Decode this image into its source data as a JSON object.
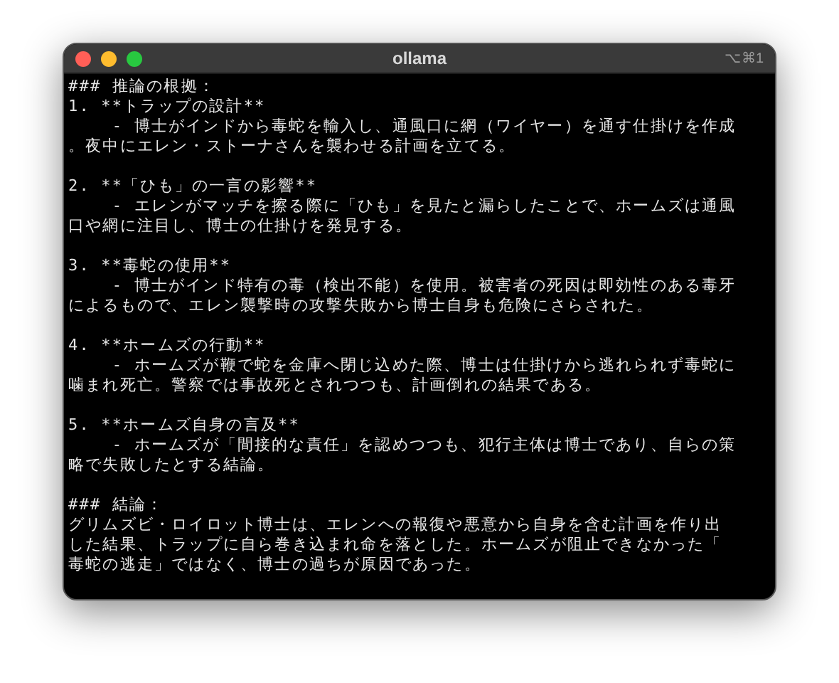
{
  "window": {
    "title": "ollama",
    "shortcut": "⌥⌘1"
  },
  "blocks": [
    {
      "lines": [
        "### 推論の根拠：",
        "1. **トラップの設計**",
        "    - 博士がインドから毒蛇を輸入し、通風口に網（ワイヤー）を通す仕掛けを作成",
        "。夜中にエレン・ストーナさんを襲わせる計画を立てる。"
      ]
    },
    {
      "lines": [
        "2. **「ひも」の一言の影響**",
        "    - エレンがマッチを擦る際に「ひも」を見たと漏らしたことで、ホームズは通風",
        "口や網に注目し、博士の仕掛けを発見する。"
      ]
    },
    {
      "lines": [
        "3. **毒蛇の使用**",
        "    - 博士がインド特有の毒（検出不能）を使用。被害者の死因は即効性のある毒牙",
        "によるもので、エレン襲撃時の攻撃失敗から博士自身も危険にさらされた。"
      ]
    },
    {
      "lines": [
        "4. **ホームズの行動**",
        "    - ホームズが鞭で蛇を金庫へ閉じ込めた際、博士は仕掛けから逃れられず毒蛇に",
        "噛まれ死亡。警察では事故死とされつつも、計画倒れの結果である。"
      ]
    },
    {
      "lines": [
        "5. **ホームズ自身の言及**",
        "    - ホームズが「間接的な責任」を認めつつも、犯行主体は博士であり、自らの策",
        "略で失敗したとする結論。"
      ]
    },
    {
      "lines": [
        "### 結論：",
        "グリムズビ・ロイロット博士は、エレンへの報復や悪意から自身を含む計画を作り出",
        "した結果、トラップに自ら巻き込まれ命を落とした。ホームズが阻止できなかった「",
        "毒蛇の逃走」ではなく、博士の過ちが原因であった。"
      ]
    }
  ]
}
